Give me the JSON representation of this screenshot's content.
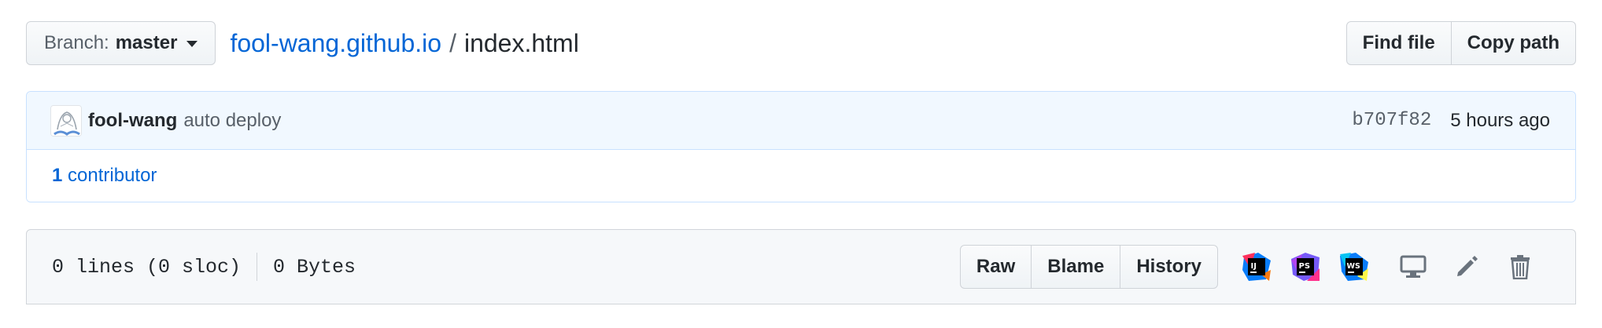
{
  "header": {
    "branch_prefix": "Branch:",
    "branch_name": "master",
    "repo": "fool-wang.github.io",
    "separator": "/",
    "file": "index.html",
    "find_file_label": "Find file",
    "copy_path_label": "Copy path"
  },
  "commit": {
    "author": "fool-wang",
    "message": "auto deploy",
    "sha": "b707f82",
    "time": "5 hours ago"
  },
  "contributors": {
    "count": "1",
    "label": "contributor"
  },
  "file_header": {
    "lines": "0 lines (0 sloc)",
    "size": "0 Bytes",
    "raw_label": "Raw",
    "blame_label": "Blame",
    "history_label": "History"
  },
  "ide_icons": [
    {
      "name": "intellij-icon",
      "text": "IJ",
      "colors": [
        "#fe315d",
        "#087cfa",
        "#f97a12"
      ]
    },
    {
      "name": "phpstorm-icon",
      "text": "PS",
      "colors": [
        "#b345f1",
        "#765af8",
        "#ff318c"
      ]
    },
    {
      "name": "webstorm-icon",
      "text": "WS",
      "colors": [
        "#07c3f2",
        "#087cfa",
        "#fcf84a"
      ]
    }
  ],
  "colors": {
    "link": "#0366d6",
    "commit_bg": "#f1f8ff",
    "commit_border": "#c8e1ff",
    "file_header_bg": "#f6f8fa",
    "icon_gray": "#6a737d"
  }
}
